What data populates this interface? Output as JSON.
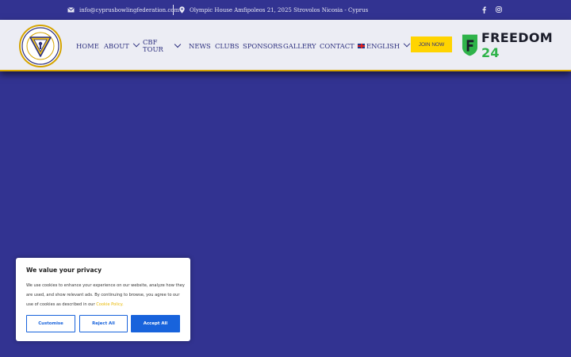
{
  "topbar": {
    "email": "info@cyprusbowlingfederation.com",
    "address": "Olympic House Amfipoleos 21, 2025 Strovolos Nicosia - Cyprus"
  },
  "nav": {
    "home": "HOME",
    "about": "ABOUT",
    "cbf_line1": "CBF",
    "cbf_line2": "TOUR",
    "news": "NEWS",
    "clubs": "CLUBS",
    "sponsors": "SPONSORS",
    "gallery": "GALLERY",
    "contact": "CONTACT",
    "language": "ENGLISH",
    "join": "JOIN NOW"
  },
  "sponsor": {
    "word": "FREEDOM",
    "number": "24"
  },
  "cookie": {
    "title": "We value your privacy",
    "text": "We use cookies to enhance your experience on our website, analyze how they are used, and show relevant ads. By continuing to browse, you agree to our use of cookies as described in our",
    "policy_link": "Cookie Policy.",
    "customise": "Customise",
    "reject": "Reject All",
    "accept": "Accept All"
  },
  "colors": {
    "brand_blue": "#323391",
    "accent_yellow": "#ffd400",
    "button_blue": "#1863dc",
    "sponsor_green": "#2fb34a"
  }
}
